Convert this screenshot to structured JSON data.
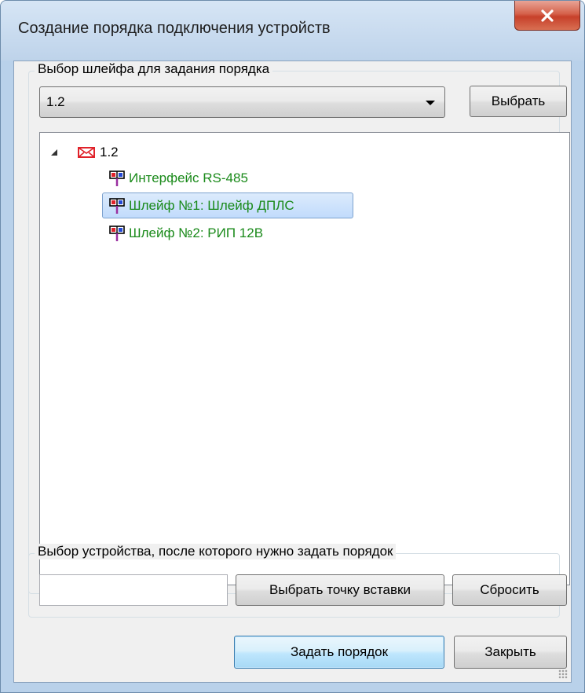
{
  "window": {
    "title": "Создание порядка подключения устройств",
    "close_glyph": "x"
  },
  "loop_group": {
    "label": "Выбор шлейфа для задания порядка",
    "combo_value": "1.2",
    "select_button": "Выбрать"
  },
  "tree": {
    "root": {
      "label": "1.2",
      "icon": "loop-envelope-icon",
      "expanded": true
    },
    "children": [
      {
        "label": "Интерфейс RS-485",
        "icon": "device-icon",
        "selected": false
      },
      {
        "label": "Шлейф №1: Шлейф ДПЛС",
        "icon": "device-icon",
        "selected": true
      },
      {
        "label": "Шлейф №2: РИП 12В",
        "icon": "device-icon",
        "selected": false
      }
    ]
  },
  "device_group": {
    "label": "Выбор устройства, после которого нужно задать порядок",
    "field_value": "",
    "pick_button": "Выбрать точку вставки",
    "reset_button": "Сбросить"
  },
  "footer": {
    "set_order_button": "Задать порядок",
    "close_button": "Закрыть"
  },
  "colors": {
    "tree_item_text": "#1a8a1a",
    "close_button": "#c7402a",
    "selection": "#c1dbfc"
  }
}
